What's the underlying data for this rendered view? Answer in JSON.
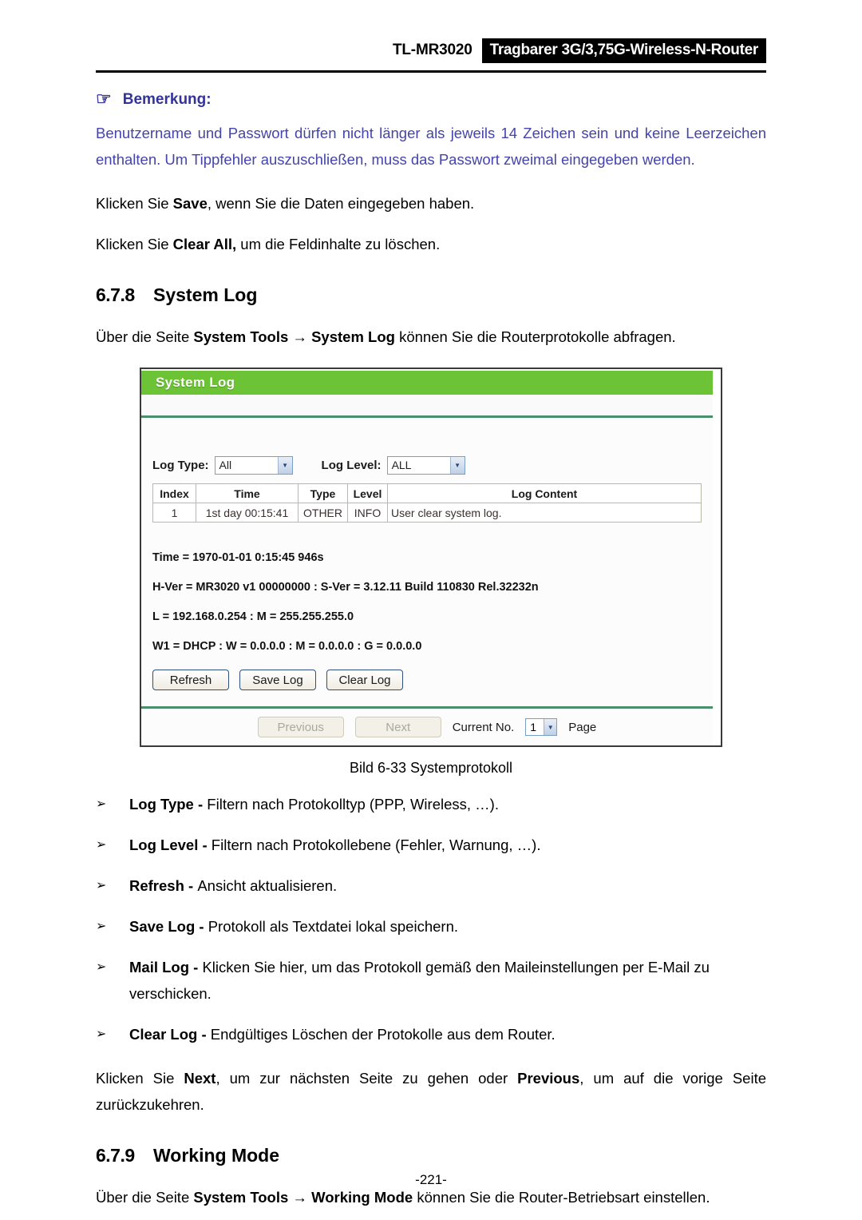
{
  "header": {
    "model": "TL-MR3020",
    "product": "Tragbarer 3G/3,75G-Wireless-N-Router"
  },
  "note": {
    "icon": "pointing-hand-icon",
    "title": "Bemerkung:",
    "body": "Benutzername und Passwort dürfen nicht länger als jeweils 14 Zeichen sein und keine Leerzeichen enthalten. Um Tippfehler auszuschließen, muss das Passwort zweimal eingegeben werden.",
    "color": "#4444aa"
  },
  "paragraphs": {
    "save_line_pre": "Klicken Sie ",
    "save_line_bold": "Save",
    "save_line_post": ", wenn Sie die Daten eingegeben haben.",
    "clear_line_pre": "Klicken Sie ",
    "clear_line_bold": "Clear All,",
    "clear_line_post": " um die Feldinhalte zu löschen."
  },
  "section_678": {
    "number": "6.7.8",
    "title": "System Log",
    "intro_pre": "Über die Seite ",
    "intro_bold1": "System Tools",
    "intro_mid": " → ",
    "intro_bold2": "System Log",
    "intro_post": " können Sie die Routerprotokolle abfragen."
  },
  "router_ui": {
    "panel_title": "System Log",
    "accent_green": "#6cc335",
    "filters": [
      {
        "label": "Log Type:",
        "value": "All"
      },
      {
        "label": "Log Level:",
        "value": "ALL"
      }
    ],
    "table": {
      "headers": [
        "Index",
        "Time",
        "Type",
        "Level",
        "Log Content"
      ],
      "rows": [
        {
          "index": "1",
          "time": "1st day 00:15:41",
          "type": "OTHER",
          "level": "INFO",
          "content": "User clear system log."
        }
      ]
    },
    "info_lines": [
      "Time = 1970-01-01 0:15:45 946s",
      "H-Ver = MR3020 v1 00000000 : S-Ver = 3.12.11 Build 110830 Rel.32232n",
      "L = 192.168.0.254 : M = 255.255.255.0",
      "W1 = DHCP : W = 0.0.0.0 : M = 0.0.0.0 : G = 0.0.0.0"
    ],
    "buttons": [
      {
        "label": "Refresh"
      },
      {
        "label": "Save Log"
      },
      {
        "label": "Clear Log"
      }
    ],
    "pager": {
      "previous": "Previous",
      "next": "Next",
      "current_label": "Current No.",
      "current_value": "1",
      "page_label": "Page"
    }
  },
  "figure_caption": "Bild 6-33 Systemprotokoll",
  "bullets": [
    {
      "marker": "➢",
      "term": "Log Type - ",
      "desc": "Filtern nach Protokolltyp (PPP, Wireless, …)."
    },
    {
      "marker": "➢",
      "term": "Log Level - ",
      "desc": "Filtern nach Protokollebene (Fehler, Warnung, …)."
    },
    {
      "marker": "➢",
      "term": "Refresh - ",
      "desc": "Ansicht aktualisieren."
    },
    {
      "marker": "➢",
      "term": "Save Log - ",
      "desc": "Protokoll als Textdatei lokal speichern."
    },
    {
      "marker": "➢",
      "term": "Mail Log - ",
      "desc": "Klicken Sie hier, um das Protokoll gemäß den Maileinstellungen per E-Mail zu verschicken."
    },
    {
      "marker": "➢",
      "term": "Clear Log - ",
      "desc": "Endgültiges Löschen der Protokolle aus dem Router."
    }
  ],
  "nav_paragraph": {
    "pre": "Klicken Sie ",
    "bold1": "Next",
    "mid": ", um zur nächsten Seite zu gehen oder ",
    "bold2": "Previous",
    "post": ", um auf die vorige Seite zurückzukehren."
  },
  "section_679": {
    "number": "6.7.9",
    "title": "Working Mode",
    "intro_pre": "Über die Seite ",
    "intro_bold1": "System Tools",
    "intro_mid": " → ",
    "intro_bold2": "Working Mode",
    "intro_post": " können Sie die Router-Betriebsart einstellen."
  },
  "footer": {
    "page_number": "-221-"
  }
}
